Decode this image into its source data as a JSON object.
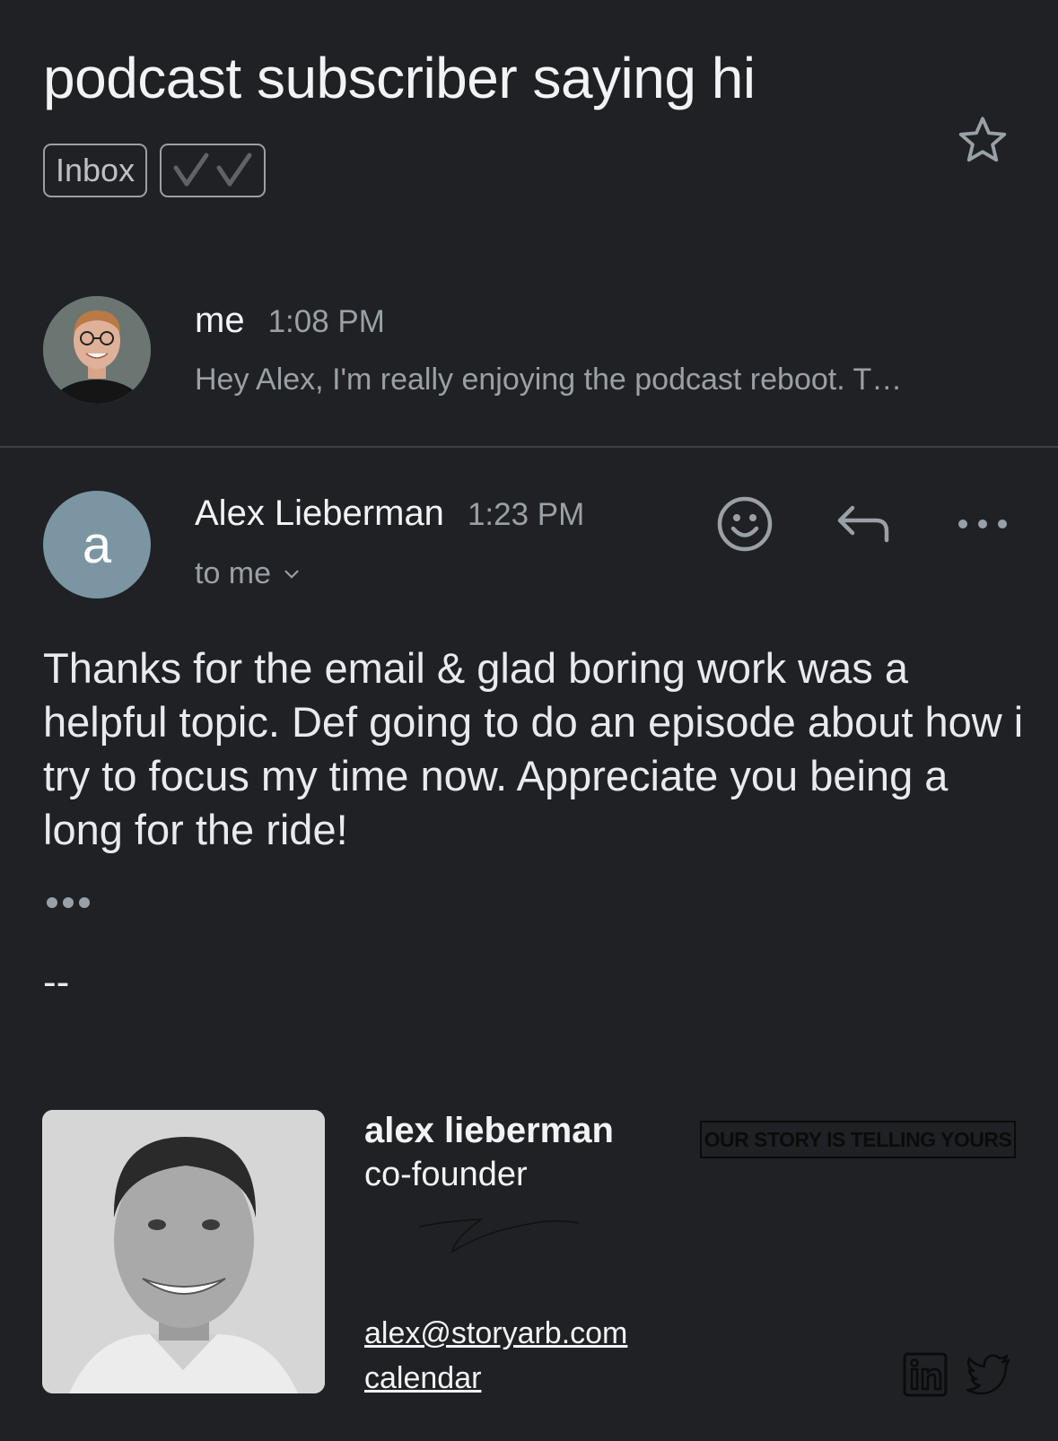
{
  "email": {
    "subject": "podcast subscriber saying hi",
    "labels": [
      "Inbox"
    ],
    "importance_marker": "✓✓",
    "starred": false
  },
  "messages": [
    {
      "sender": "me",
      "time": "1:08 PM",
      "snippet": "Hey Alex, I'm really enjoying the podcast reboot. T…",
      "avatar": "profile-photo"
    },
    {
      "sender": "Alex Lieberman",
      "avatar_letter": "a",
      "avatar_color": "#7b95a3",
      "time": "1:23 PM",
      "recipients": "to me",
      "body": "Thanks for the email & glad boring work was a helpful topic. Def going to do an episode about how i try to focus my time now. Appreciate you being a long for the ride!",
      "signature_separator": "--",
      "signature": {
        "name": "alex lieberman",
        "title": "co-founder",
        "motto": "OUR STORY IS TELLING YOURS",
        "email": "alex@storyarb.com",
        "calendar": "calendar",
        "social": [
          "linkedin-icon",
          "twitter-icon"
        ]
      }
    }
  ],
  "icons": {
    "star": "star-outline-icon",
    "react": "emoji-icon",
    "reply": "reply-icon",
    "more": "more-horizontal-icon",
    "expand": "chevron-down-icon"
  }
}
